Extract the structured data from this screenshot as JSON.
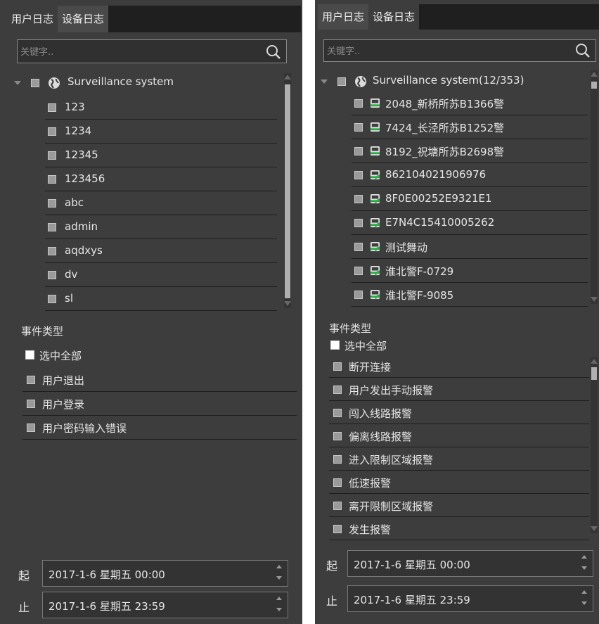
{
  "left": {
    "tabs": [
      {
        "label": "用户日志"
      },
      {
        "label": "设备日志"
      }
    ],
    "search_placeholder": "关键字..",
    "tree_root": "Surveillance system",
    "users": [
      {
        "label": "123"
      },
      {
        "label": "1234"
      },
      {
        "label": "12345"
      },
      {
        "label": "123456"
      },
      {
        "label": "abc"
      },
      {
        "label": "admin"
      },
      {
        "label": "aqdxys"
      },
      {
        "label": "dv"
      },
      {
        "label": "sl"
      }
    ],
    "event_title": "事件类型",
    "select_all": "选中全部",
    "events": [
      {
        "label": "用户退出"
      },
      {
        "label": "用户登录"
      },
      {
        "label": "用户密码输入错误"
      }
    ],
    "start_label": "起",
    "start_value": "2017-1-6 星期五 00:00",
    "end_label": "止",
    "end_value": "2017-1-6 星期五 23:59"
  },
  "right": {
    "tabs": [
      {
        "label": "用户日志"
      },
      {
        "label": "设备日志"
      }
    ],
    "search_placeholder": "关键字..",
    "tree_root": "Surveillance system(12/353)",
    "devices": [
      {
        "label": "2048_新桥所苏B1366警",
        "icon": "bus-icon"
      },
      {
        "label": "7424_长泾所苏B1252警",
        "icon": "bus-icon"
      },
      {
        "label": "8192_祝塘所苏B2698警",
        "icon": "bus-icon"
      },
      {
        "label": "862104021906976",
        "icon": "bus-signal-icon"
      },
      {
        "label": "8F0E00252E9321E1",
        "icon": "bus-signal-icon"
      },
      {
        "label": "E7N4C15410005262",
        "icon": "bus-signal-icon"
      },
      {
        "label": "测试舞动",
        "icon": "bus-signal-icon"
      },
      {
        "label": "淮北警F-0729",
        "icon": "bus-signal-icon"
      },
      {
        "label": "淮北警F-9085",
        "icon": "bus-signal-icon"
      }
    ],
    "event_title": "事件类型",
    "select_all": "选中全部",
    "events": [
      {
        "label": "断开连接"
      },
      {
        "label": "用户发出手动报警"
      },
      {
        "label": "闯入线路报警"
      },
      {
        "label": "偏离线路报警"
      },
      {
        "label": "进入限制区域报警"
      },
      {
        "label": "低速报警"
      },
      {
        "label": "离开限制区域报警"
      },
      {
        "label": "发生报警"
      }
    ],
    "start_label": "起",
    "start_value": "2017-1-6 星期五 00:00",
    "end_label": "止",
    "end_value": "2017-1-6 星期五 23:59"
  },
  "colors": {
    "panel_bg": "#3d3d3d",
    "tabbar_bg": "#1f1f1f",
    "checkbox": "#9a9a9a",
    "icon_green": "#2ea84a"
  }
}
